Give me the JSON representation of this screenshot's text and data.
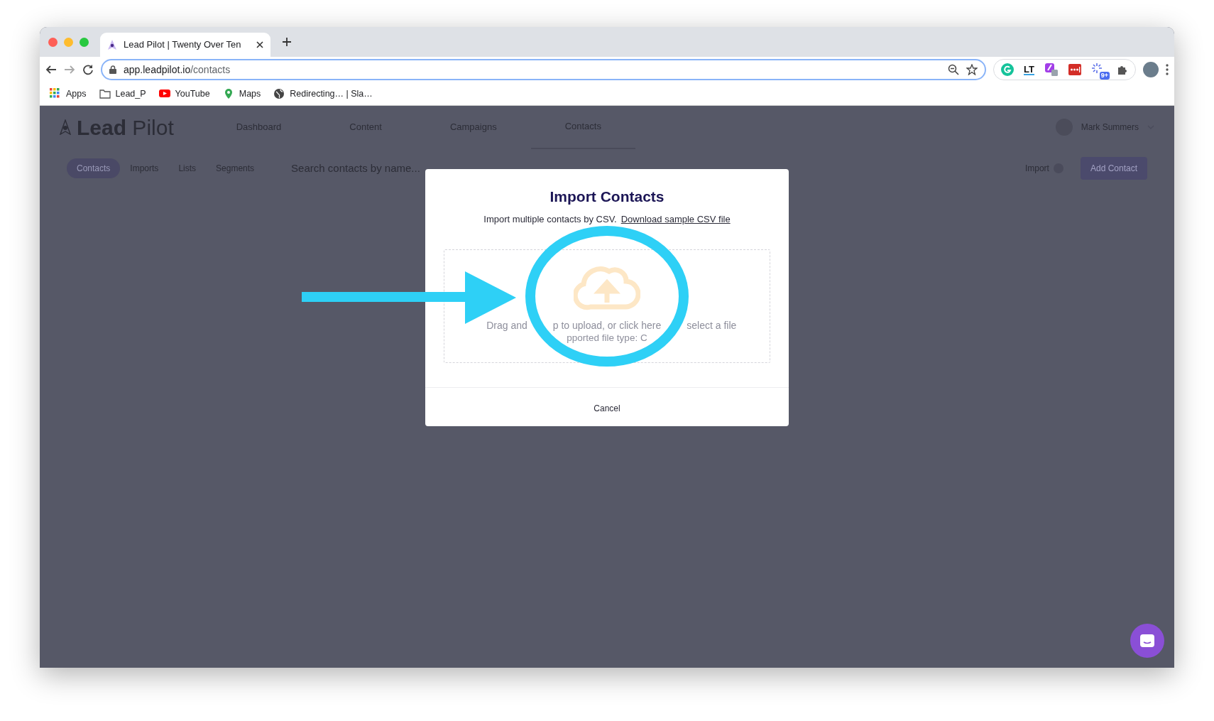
{
  "browser": {
    "tab_title": "Lead Pilot | Twenty Over Ten",
    "url_host": "app.leadpilot.io",
    "url_path": "/contacts",
    "bookmarks": [
      {
        "label": "Apps",
        "kind": "apps"
      },
      {
        "label": "Lead_P",
        "kind": "folder"
      },
      {
        "label": "YouTube",
        "kind": "youtube"
      },
      {
        "label": "Maps",
        "kind": "maps"
      },
      {
        "label": "Redirecting… | Sla…",
        "kind": "globe"
      }
    ],
    "extensions": [
      {
        "kind": "grammarly"
      },
      {
        "kind": "lt",
        "label": "LT"
      },
      {
        "kind": "pen"
      },
      {
        "kind": "dots"
      },
      {
        "kind": "spark",
        "badge": "9+"
      },
      {
        "kind": "puzzle"
      }
    ]
  },
  "app": {
    "brand": "**Lead** Pilot",
    "nav": [
      {
        "label": "Dashboard",
        "selected": false
      },
      {
        "label": "Content",
        "selected": false
      },
      {
        "label": "Campaigns",
        "selected": false
      },
      {
        "label": "Contacts",
        "selected": true
      }
    ],
    "user": "Mark Summers",
    "subtabs": [
      {
        "label": "Contacts",
        "selected": true
      },
      {
        "label": "Imports",
        "selected": false
      },
      {
        "label": "Lists",
        "selected": false
      },
      {
        "label": "Segments",
        "selected": false
      }
    ],
    "search": {
      "placeholder": "Search contacts by name..."
    },
    "import_label": "Import",
    "add_button": "Add Contact"
  },
  "modal": {
    "title": "Import Contacts",
    "subtitle": "Import multiple contacts by CSV.",
    "link": "Download sample CSV file",
    "hint_pieces": [
      "Drag and",
      "p to upload, or click here",
      "select a file"
    ],
    "hint_line2": "pported file type: C",
    "cancel": "Cancel"
  }
}
